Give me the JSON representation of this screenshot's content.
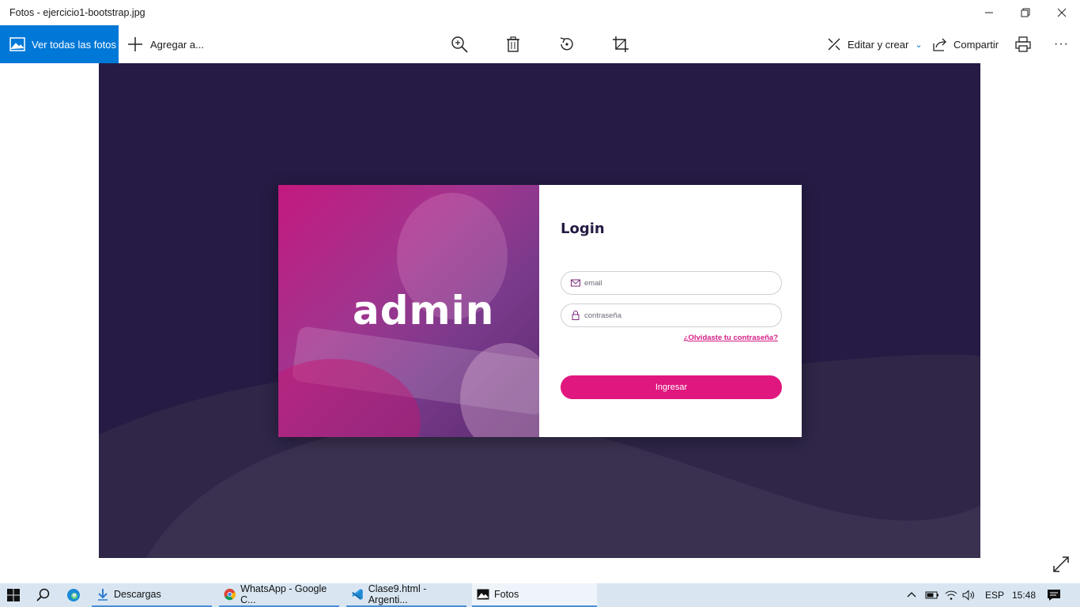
{
  "window": {
    "title": "Fotos - ejercicio1-bootstrap.jpg"
  },
  "toolbar": {
    "all_photos_label": "Ver todas las fotos",
    "add_to_label": "Agregar a...",
    "edit_create_label": "Editar y crear",
    "share_label": "Compartir",
    "more_label": "···"
  },
  "image": {
    "logo": "admin",
    "login_title": "Login",
    "email_placeholder": "email",
    "password_placeholder": "contraseña",
    "forgot_label": "¿Olvidaste tu contraseña?",
    "submit_label": "Ingresar",
    "colors": {
      "background": "#261b44",
      "accent": "#e0177f"
    }
  },
  "taskbar": {
    "apps": [
      {
        "label": "Descargas",
        "icon": "download-folder-icon"
      },
      {
        "label": "WhatsApp - Google C...",
        "icon": "chrome-icon"
      },
      {
        "label": "Clase9.html - Argenti...",
        "icon": "vscode-icon"
      },
      {
        "label": "Fotos",
        "icon": "photos-icon"
      }
    ],
    "language": "ESP",
    "time": "15:48"
  }
}
